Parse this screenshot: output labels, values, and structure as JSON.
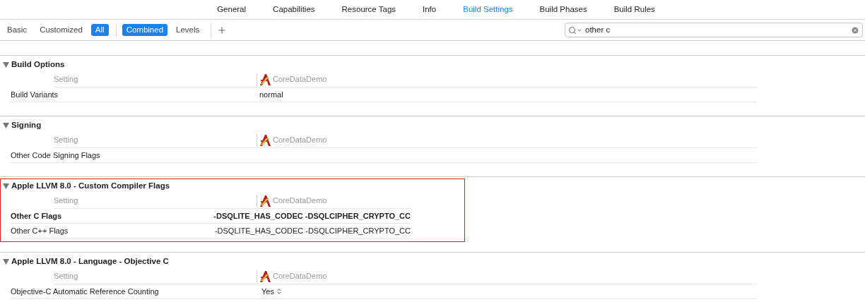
{
  "tabs": [
    {
      "label": "General",
      "selected": false
    },
    {
      "label": "Capabilities",
      "selected": false
    },
    {
      "label": "Resource Tags",
      "selected": false
    },
    {
      "label": "Info",
      "selected": false
    },
    {
      "label": "Build Settings",
      "selected": true
    },
    {
      "label": "Build Phases",
      "selected": false
    },
    {
      "label": "Build Rules",
      "selected": false
    }
  ],
  "filter_groups": [
    [
      {
        "label": "Basic",
        "selected": false
      },
      {
        "label": "Customized",
        "selected": false
      },
      {
        "label": "All",
        "selected": true
      }
    ],
    [
      {
        "label": "Combined",
        "selected": true
      },
      {
        "label": "Levels",
        "selected": false
      }
    ]
  ],
  "search": {
    "value": "other c"
  },
  "sections": [
    {
      "title": "Build Options",
      "expanded": true,
      "highlighted": false,
      "setting_header": "Setting",
      "target": "CoreDataDemo",
      "rows": [
        {
          "name": "Build Variants",
          "value": "normal",
          "bold": false,
          "kind": "text"
        }
      ]
    },
    {
      "title": "Signing",
      "expanded": true,
      "highlighted": false,
      "setting_header": "Setting",
      "target": "CoreDataDemo",
      "rows": [
        {
          "name": "Other Code Signing Flags",
          "bold": false
        }
      ]
    },
    {
      "title": "Apple LLVM 8.0 - Custom Compiler Flags",
      "expanded": true,
      "highlighted": true,
      "setting_header": "Setting",
      "target": "CoreDataDemo",
      "rows": [
        {
          "name": "Other C Flags",
          "value": "-DSQLITE_HAS_CODEC -DSQLCIPHER_CRYPTO_CC",
          "bold": true,
          "kind": "text"
        },
        {
          "name": "Other C++ Flags",
          "value": "-DSQLITE_HAS_CODEC -DSQLCIPHER_CRYPTO_CC",
          "bold": false,
          "kind": "text"
        }
      ]
    },
    {
      "title": "Apple LLVM 8.0 - Language - Objective C",
      "expanded": true,
      "highlighted": false,
      "setting_header": "Setting",
      "target": "CoreDataDemo",
      "rows": [
        {
          "name": "Objective-C Automatic Reference Counting",
          "value": "Yes",
          "bold": false,
          "kind": "popup"
        }
      ]
    }
  ]
}
